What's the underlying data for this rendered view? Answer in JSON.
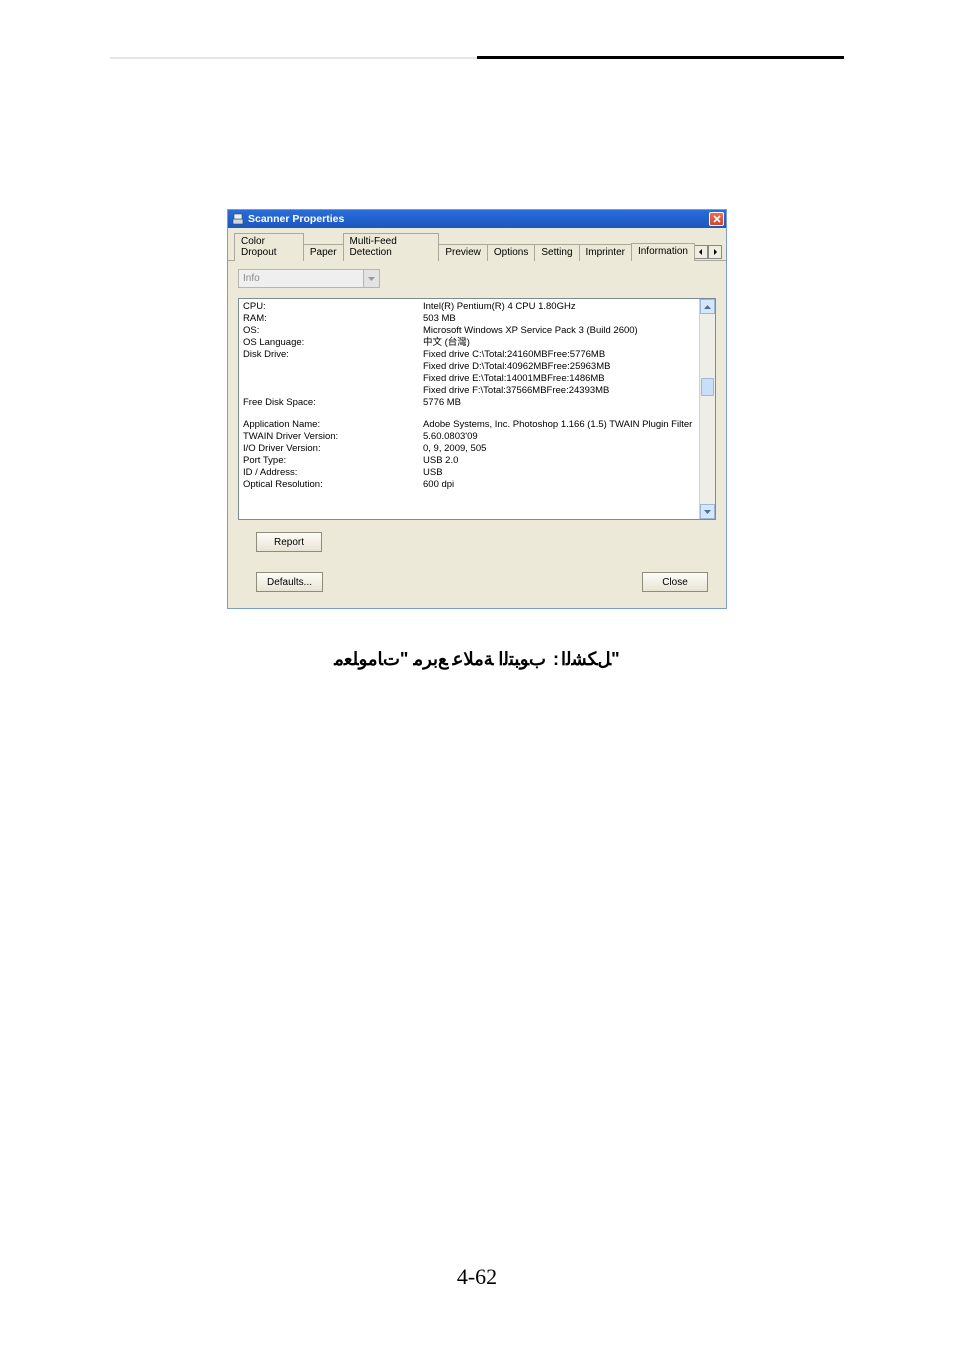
{
  "window": {
    "title": "Scanner Properties",
    "tabs": [
      "Color Dropout",
      "Paper",
      "Multi-Feed Detection",
      "Preview",
      "Options",
      "Setting",
      "Imprinter",
      "Information"
    ],
    "active_tab_index": 7,
    "info_select": "Info",
    "report_button": "Report",
    "defaults_button": "Defaults...",
    "close_button": "Close"
  },
  "info_rows": [
    {
      "key": "CPU:",
      "value": "Intel(R) Pentium(R) 4 CPU 1.80GHz"
    },
    {
      "key": "RAM:",
      "value": "503 MB"
    },
    {
      "key": "OS:",
      "value": "Microsoft Windows XP Service Pack 3 (Build 2600)"
    },
    {
      "key": "OS Language:",
      "value": "中文 (台灣)"
    },
    {
      "key": "Disk Drive:",
      "value": "Fixed drive C:\\Total:24160MBFree:5776MB"
    },
    {
      "key": "",
      "value": "Fixed drive D:\\Total:40962MBFree:25963MB"
    },
    {
      "key": "",
      "value": "Fixed drive E:\\Total:14001MBFree:1486MB"
    },
    {
      "key": "",
      "value": "Fixed drive F:\\Total:37566MBFree:24393MB"
    },
    {
      "key": "Free Disk Space:",
      "value": "5776 MB"
    }
  ],
  "info_rows2": [
    {
      "key": "Application Name:",
      "value": "Adobe Systems, Inc. Photoshop 1.166 (1.5) TWAIN Plugin Filter"
    },
    {
      "key": "TWAIN Driver Version:",
      "value": "5.60.0803'09"
    },
    {
      "key": "I/O Driver Version:",
      "value": "0, 9, 2009, 505"
    },
    {
      "key": "Port Type:",
      "value": "USB 2.0"
    },
    {
      "key": "ID / Address:",
      "value": "USB"
    },
    {
      "key": "Optical Resolution:",
      "value": "600 dpi"
    }
  ],
  "caption_parts": {
    "left": "ﻞﻜﺸﻟﺍ",
    "sep": ":",
    "right": "ﺏﻮﺒﺘﻟﺍ ﺔﻣﻼﻋ ﻊﺑﺮﻣ \"ﺕﺎﻣﻮﻠﻌﻣ\""
  },
  "page_number": "4-62"
}
